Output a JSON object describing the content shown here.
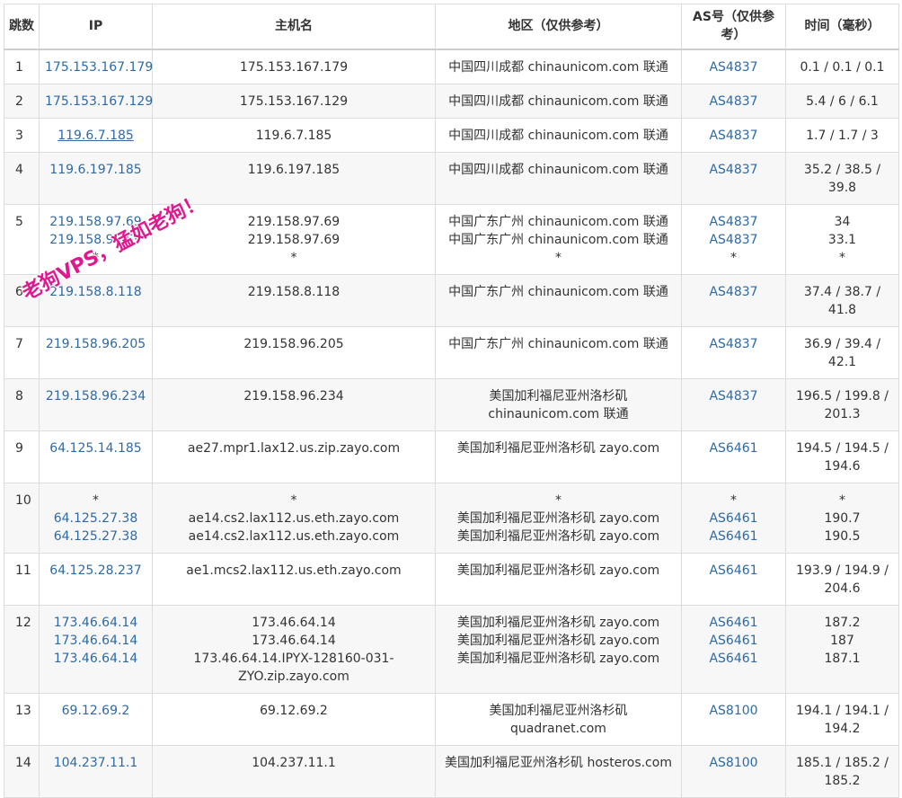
{
  "headers": {
    "hop": "跳数",
    "ip": "IP",
    "host": "主机名",
    "region": "地区（仅供参考）",
    "asn": "AS号（仅供参考）",
    "time": "时间（毫秒）"
  },
  "watermark": "老狗VPS，猛如老狗！",
  "colors": {
    "link": "#2e6aa6",
    "watermark": "#e0188f",
    "border": "#dcdcdc",
    "stripe": "#f7f7f7"
  },
  "rows": [
    {
      "hop": "1",
      "ip": [
        "175.153.167.179"
      ],
      "host": [
        "175.153.167.179"
      ],
      "region": [
        "中国四川成都 chinaunicom.com 联通"
      ],
      "asn": [
        "AS4837"
      ],
      "time": [
        "0.1 / 0.1 / 0.1"
      ]
    },
    {
      "hop": "2",
      "ip": [
        "175.153.167.129"
      ],
      "host": [
        "175.153.167.129"
      ],
      "region": [
        "中国四川成都 chinaunicom.com 联通"
      ],
      "asn": [
        "AS4837"
      ],
      "time": [
        "5.4 / 6 / 6.1"
      ]
    },
    {
      "hop": "3",
      "ip": [
        "119.6.7.185"
      ],
      "ip_underline": true,
      "host": [
        "119.6.7.185"
      ],
      "region": [
        "中国四川成都 chinaunicom.com 联通"
      ],
      "asn": [
        "AS4837"
      ],
      "time": [
        "1.7 / 1.7 / 3"
      ]
    },
    {
      "hop": "4",
      "ip": [
        "119.6.197.185"
      ],
      "host": [
        "119.6.197.185"
      ],
      "region": [
        "中国四川成都 chinaunicom.com 联通"
      ],
      "asn": [
        "AS4837"
      ],
      "time": [
        "35.2 / 38.5 /",
        "39.8"
      ]
    },
    {
      "hop": "5",
      "ip": [
        "219.158.97.69",
        "219.158.97.69",
        "*"
      ],
      "host": [
        "219.158.97.69",
        "219.158.97.69",
        "*"
      ],
      "region": [
        "中国广东广州 chinaunicom.com 联通",
        "中国广东广州 chinaunicom.com 联通",
        "*"
      ],
      "asn": [
        "AS4837",
        "AS4837",
        "*"
      ],
      "time": [
        "34",
        "33.1",
        "*"
      ]
    },
    {
      "hop": "6",
      "ip": [
        "219.158.8.118"
      ],
      "host": [
        "219.158.8.118"
      ],
      "region": [
        "中国广东广州 chinaunicom.com 联通"
      ],
      "asn": [
        "AS4837"
      ],
      "time": [
        "37.4 / 38.7 /",
        "41.8"
      ]
    },
    {
      "hop": "7",
      "ip": [
        "219.158.96.205"
      ],
      "host": [
        "219.158.96.205"
      ],
      "region": [
        "中国广东广州 chinaunicom.com 联通"
      ],
      "asn": [
        "AS4837"
      ],
      "time": [
        "36.9 / 39.4 /",
        "42.1"
      ]
    },
    {
      "hop": "8",
      "ip": [
        "219.158.96.234"
      ],
      "host": [
        "219.158.96.234"
      ],
      "region": [
        "美国加利福尼亚州洛杉矶",
        "chinaunicom.com 联通"
      ],
      "asn": [
        "AS4837"
      ],
      "time": [
        "196.5 / 199.8 /",
        "201.3"
      ]
    },
    {
      "hop": "9",
      "ip": [
        "64.125.14.185"
      ],
      "host": [
        "ae27.mpr1.lax12.us.zip.zayo.com"
      ],
      "region": [
        "美国加利福尼亚州洛杉矶 zayo.com"
      ],
      "asn": [
        "AS6461"
      ],
      "time": [
        "194.5 / 194.5 /",
        "194.6"
      ]
    },
    {
      "hop": "10",
      "ip": [
        "*",
        "64.125.27.38",
        "64.125.27.38"
      ],
      "host": [
        "*",
        "ae14.cs2.lax112.us.eth.zayo.com",
        "ae14.cs2.lax112.us.eth.zayo.com"
      ],
      "region": [
        "*",
        "美国加利福尼亚州洛杉矶 zayo.com",
        "美国加利福尼亚州洛杉矶 zayo.com"
      ],
      "asn": [
        "*",
        "AS6461",
        "AS6461"
      ],
      "time": [
        "*",
        "190.7",
        "190.5"
      ]
    },
    {
      "hop": "11",
      "ip": [
        "64.125.28.237"
      ],
      "host": [
        "ae1.mcs2.lax112.us.eth.zayo.com"
      ],
      "region": [
        "美国加利福尼亚州洛杉矶 zayo.com"
      ],
      "asn": [
        "AS6461"
      ],
      "time": [
        "193.9 / 194.9 /",
        "204.6"
      ]
    },
    {
      "hop": "12",
      "ip": [
        "173.46.64.14",
        "173.46.64.14",
        "173.46.64.14"
      ],
      "host": [
        "173.46.64.14",
        "173.46.64.14",
        "173.46.64.14.IPYX-128160-031-",
        "ZYO.zip.zayo.com"
      ],
      "region": [
        "美国加利福尼亚州洛杉矶 zayo.com",
        "美国加利福尼亚州洛杉矶 zayo.com",
        "美国加利福尼亚州洛杉矶 zayo.com"
      ],
      "asn": [
        "AS6461",
        "AS6461",
        "AS6461"
      ],
      "time": [
        "187.2",
        "187",
        "187.1"
      ]
    },
    {
      "hop": "13",
      "ip": [
        "69.12.69.2"
      ],
      "host": [
        "69.12.69.2"
      ],
      "region": [
        "美国加利福尼亚州洛杉矶",
        "quadranet.com"
      ],
      "asn": [
        "AS8100"
      ],
      "time": [
        "194.1 / 194.1 /",
        "194.2"
      ]
    },
    {
      "hop": "14",
      "ip": [
        "104.237.11.1"
      ],
      "host": [
        "104.237.11.1"
      ],
      "region": [
        "美国加利福尼亚州洛杉矶 hosteros.com"
      ],
      "asn": [
        "AS8100"
      ],
      "time": [
        "185.1 / 185.2 /",
        "185.2"
      ]
    }
  ]
}
